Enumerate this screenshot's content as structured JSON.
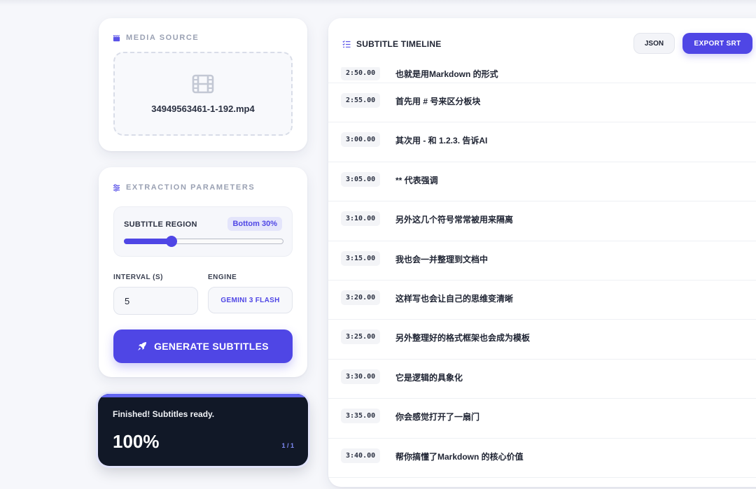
{
  "media": {
    "title": "MEDIA SOURCE",
    "icon": "clapperboard-icon",
    "filename": "34949563461-1-192.mp4"
  },
  "params": {
    "title": "EXTRACTION PARAMETERS",
    "region_label": "SUBTITLE REGION",
    "region_value": "Bottom 30%",
    "region_fraction": 0.3,
    "interval_label": "INTERVAL (S)",
    "interval_value": "5",
    "engine_label": "ENGINE",
    "engine_value": "GEMINI 3 FLASH",
    "generate_label": "GENERATE SUBTITLES"
  },
  "status": {
    "message": "Finished! Subtitles ready.",
    "percent": "100%",
    "count": "1 / 1",
    "progress": 1.0
  },
  "timeline": {
    "title": "SUBTITLE TIMELINE",
    "json_label": "JSON",
    "export_label": "EXPORT SRT",
    "rows": [
      {
        "time": "2:50.00",
        "text": "也就是用Markdown 的形式"
      },
      {
        "time": "2:55.00",
        "text": "首先用 # 号来区分板块"
      },
      {
        "time": "3:00.00",
        "text": "其次用 - 和 1.2.3. 告诉AI"
      },
      {
        "time": "3:05.00",
        "text": "** 代表强调"
      },
      {
        "time": "3:10.00",
        "text": "另外这几个符号常常被用来隔离"
      },
      {
        "time": "3:15.00",
        "text": "我也会一并整理到文档中"
      },
      {
        "time": "3:20.00",
        "text": "这样写也会让自己的思维变清晰"
      },
      {
        "time": "3:25.00",
        "text": "另外整理好的格式框架也会成为模板"
      },
      {
        "time": "3:30.00",
        "text": "它是逻辑的具象化"
      },
      {
        "time": "3:35.00",
        "text": "你会感觉打开了一扇门"
      },
      {
        "time": "3:40.00",
        "text": "帮你搞懂了Markdown 的核心价值"
      }
    ]
  },
  "colors": {
    "accent": "#4f46e5",
    "status_bg": "#111827",
    "page_bg": "#f6f7fb"
  }
}
